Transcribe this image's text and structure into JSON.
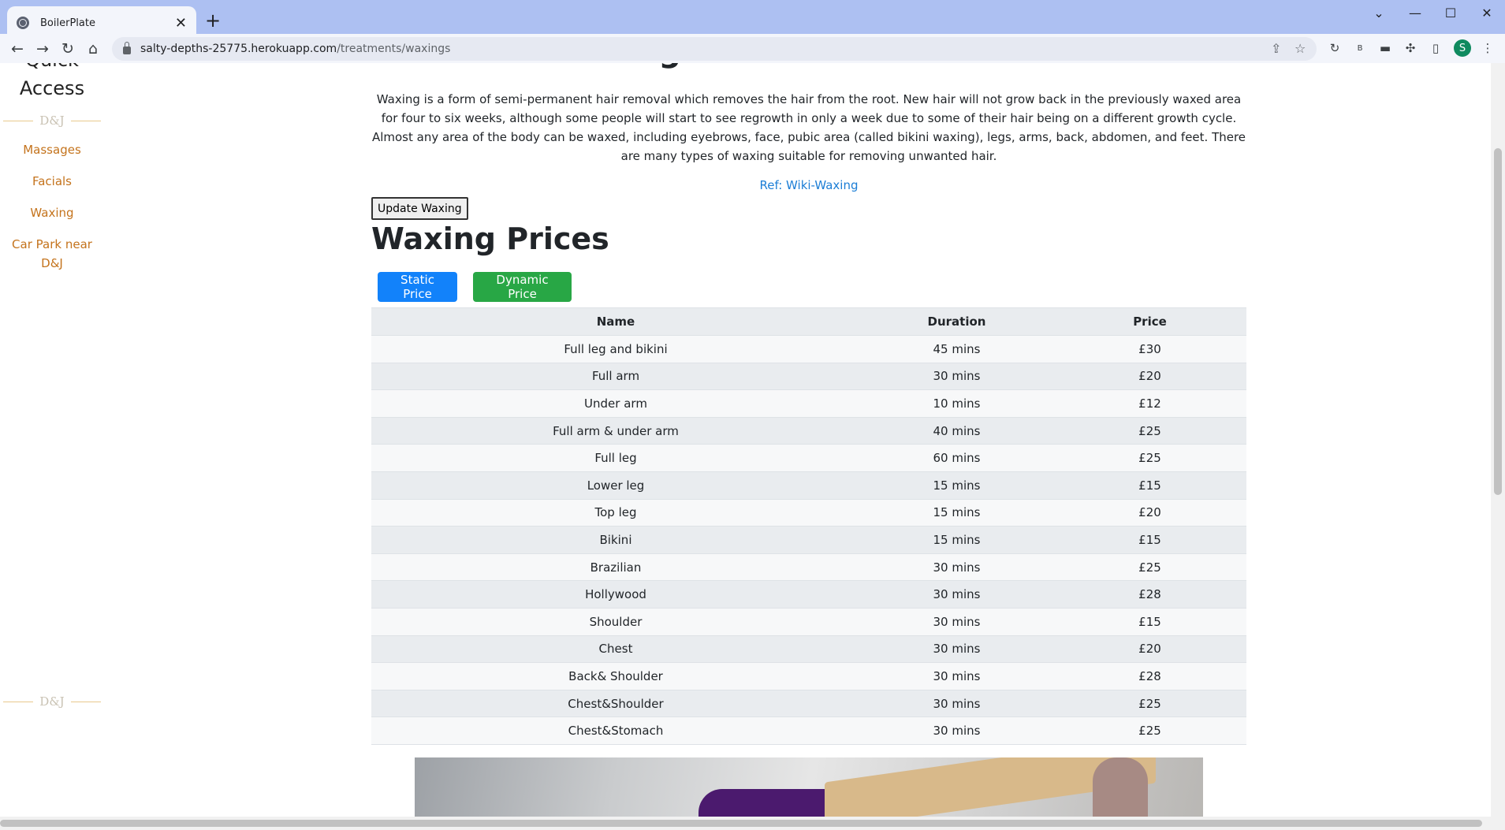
{
  "browser": {
    "tab_title": "BoilerPlate",
    "url_host": "salty-depths-25775.herokuapp.com",
    "url_path": "/treatments/waxings",
    "profile_initial": "S"
  },
  "sidebar": {
    "title": "Quick Access",
    "divider_mark": "D&J",
    "links": [
      "Massages",
      "Facials",
      "Waxing",
      "Car Park near D&J"
    ]
  },
  "main": {
    "heading": "Waxing Treatments Available",
    "intro": "Waxing is a form of semi-permanent hair removal which removes the hair from the root. New hair will not grow back in the previously waxed area for four to six weeks, although some people will start to see regrowth in only a week due to some of their hair being on a different growth cycle. Almost any area of the body can be waxed, including eyebrows, face, pubic area (called bikini waxing), legs, arms, back, abdomen, and feet. There are many types of waxing suitable for removing unwanted hair.",
    "ref_link": "Ref: Wiki-Waxing",
    "update_button": "Update Waxing",
    "prices_heading": "Waxing Prices",
    "static_button": "Static Price",
    "dynamic_button": "Dynamic Price"
  },
  "table": {
    "headers": [
      "Name",
      "Duration",
      "Price"
    ],
    "rows": [
      [
        "Full leg and bikini",
        "45 mins",
        "£30"
      ],
      [
        "Full arm",
        "30 mins",
        "£20"
      ],
      [
        "Under arm",
        "10 mins",
        "£12"
      ],
      [
        "Full arm & under arm",
        "40 mins",
        "£25"
      ],
      [
        "Full leg",
        "60 mins",
        "£25"
      ],
      [
        "Lower leg",
        "15 mins",
        "£15"
      ],
      [
        "Top leg",
        "15 mins",
        "£20"
      ],
      [
        "Bikini",
        "15 mins",
        "£15"
      ],
      [
        "Brazilian",
        "30 mins",
        "£25"
      ],
      [
        "Hollywood",
        "30 mins",
        "£28"
      ],
      [
        "Shoulder",
        "30 mins",
        "£15"
      ],
      [
        "Chest",
        "30 mins",
        "£20"
      ],
      [
        "Back& Shoulder",
        "30 mins",
        "£28"
      ],
      [
        "Chest&Shoulder",
        "30 mins",
        "£25"
      ],
      [
        "Chest&Stomach",
        "30 mins",
        "£25"
      ]
    ]
  },
  "colors": {
    "tabstrip": "#adc0f2",
    "link_orange": "#c4731c",
    "primary_blue": "#1282fa",
    "success_green": "#28a745"
  }
}
